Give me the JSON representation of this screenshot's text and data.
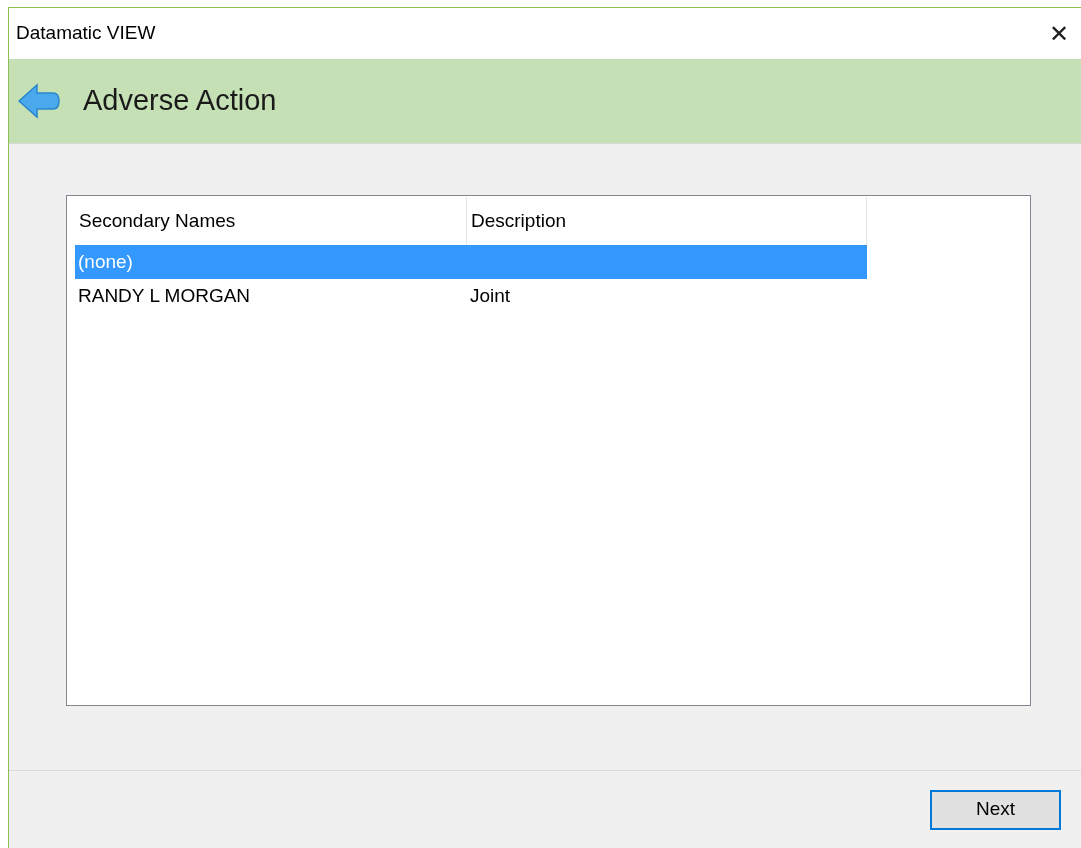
{
  "window": {
    "title": "Datamatic VIEW",
    "close": "✕"
  },
  "header": {
    "title": "Adverse Action"
  },
  "table": {
    "columns": [
      "Secondary Names",
      "Description"
    ],
    "rows": [
      {
        "cells": [
          "(none)",
          ""
        ],
        "selected": true
      },
      {
        "cells": [
          "RANDY L MORGAN",
          "Joint"
        ],
        "selected": false
      }
    ]
  },
  "buttons": [
    {
      "label": "Next",
      "focused": true
    }
  ]
}
